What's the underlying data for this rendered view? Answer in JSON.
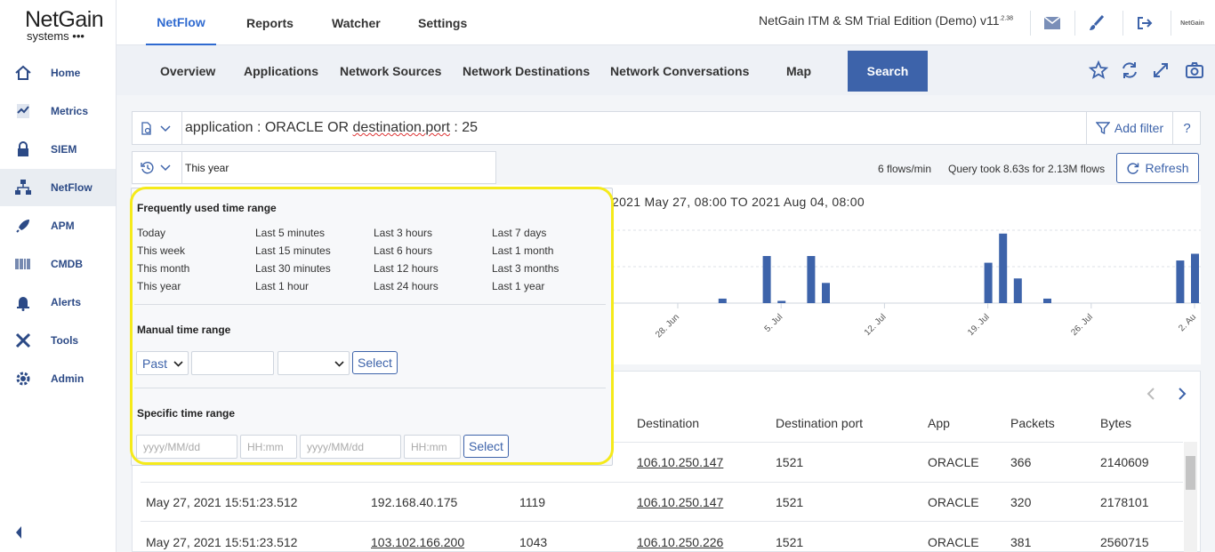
{
  "brand": {
    "name": "NetGain",
    "sub": "systems •••"
  },
  "sidebar": {
    "items": [
      {
        "label": "Home",
        "icon": "home-icon"
      },
      {
        "label": "Metrics",
        "icon": "metrics-icon"
      },
      {
        "label": "SIEM",
        "icon": "lock-icon"
      },
      {
        "label": "NetFlow",
        "icon": "network-icon"
      },
      {
        "label": "APM",
        "icon": "rocket-icon"
      },
      {
        "label": "CMDB",
        "icon": "barcode-icon"
      },
      {
        "label": "Alerts",
        "icon": "bell-icon"
      },
      {
        "label": "Tools",
        "icon": "tools-icon"
      },
      {
        "label": "Admin",
        "icon": "gear-icon"
      }
    ],
    "active": "NetFlow"
  },
  "topnav": {
    "tabs": [
      "NetFlow",
      "Reports",
      "Watcher",
      "Settings"
    ],
    "active": "NetFlow",
    "edition": "NetGain ITM & SM Trial Edition (Demo) v11",
    "version_sup": ".2.38",
    "avatar_text": "NetGain"
  },
  "subnav": {
    "tabs": [
      "Overview",
      "Applications",
      "Network Sources",
      "Network Destinations",
      "Network Conversations",
      "Map",
      "Search"
    ],
    "active": "Search"
  },
  "search": {
    "query_prefix": "application : ORACLE OR ",
    "query_field": "destination.port",
    "query_suffix": " : 25",
    "add_filter": "Add filter",
    "help": "?"
  },
  "time": {
    "value": "This year"
  },
  "stats": {
    "rate": "6 flows/min",
    "query": "Query took 8.63s for 2.13M flows"
  },
  "refresh_label": "Refresh",
  "chart": {
    "title": "2021 May 27, 08:00 TO 2021 Aug 04, 08:00",
    "ticks": [
      "28. Jun",
      "5. Jul",
      "12. Jul",
      "19. Jul",
      "26. Jul",
      "2. Au"
    ]
  },
  "chart_data": {
    "type": "bar",
    "title": "2021 May 27, 08:00 TO 2021 Aug 04, 08:00",
    "x_ticks": [
      "28. Jun",
      "5. Jul",
      "12. Jul",
      "19. Jul",
      "26. Jul",
      "2. Au"
    ],
    "values": [
      20,
      4,
      42,
      2,
      42,
      18,
      36,
      62,
      22,
      4,
      38,
      44
    ],
    "x": [
      "2021-06-21",
      "2021-07-01",
      "2021-07-04",
      "2021-07-05",
      "2021-07-07",
      "2021-07-08",
      "2021-07-19",
      "2021-07-20",
      "2021-07-21",
      "2021-07-23",
      "2021-08-01",
      "2021-08-02"
    ],
    "grid": true
  },
  "popup": {
    "freq_title": "Frequently used time range",
    "freq_cols": [
      [
        "Today",
        "This week",
        "This month",
        "This year"
      ],
      [
        "Last 5 minutes",
        "Last 15 minutes",
        "Last 30 minutes",
        "Last 1 hour"
      ],
      [
        "Last 3 hours",
        "Last 6 hours",
        "Last 12 hours",
        "Last 24 hours"
      ],
      [
        "Last 7 days",
        "Last 1 month",
        "Last 3 months",
        "Last 1 year"
      ]
    ],
    "manual_title": "Manual time range",
    "manual_dir": "Past",
    "select_label": "Select",
    "specific_title": "Specific time range",
    "date_ph": "yyyy/MM/dd",
    "time_ph": "HH:mm"
  },
  "table": {
    "headers": [
      "Destination",
      "Destination port",
      "App",
      "Packets",
      "Bytes"
    ],
    "rows": [
      {
        "time": "",
        "source": "",
        "sport": "",
        "dest": "106.10.250.147",
        "dport": "1521",
        "app": "ORACLE",
        "packets": "366",
        "bytes": "2140609"
      },
      {
        "time": "May 27, 2021 15:51:23.512",
        "source": "192.168.40.175",
        "sport": "1119",
        "dest": "106.10.250.147",
        "dport": "1521",
        "app": "ORACLE",
        "packets": "320",
        "bytes": "2178101"
      },
      {
        "time": "May 27, 2021 15:51:23.512",
        "source": "103.102.166.200",
        "sport": "1043",
        "dest": "106.10.250.226",
        "dport": "1521",
        "app": "ORACLE",
        "packets": "381",
        "bytes": "2560715"
      }
    ]
  }
}
